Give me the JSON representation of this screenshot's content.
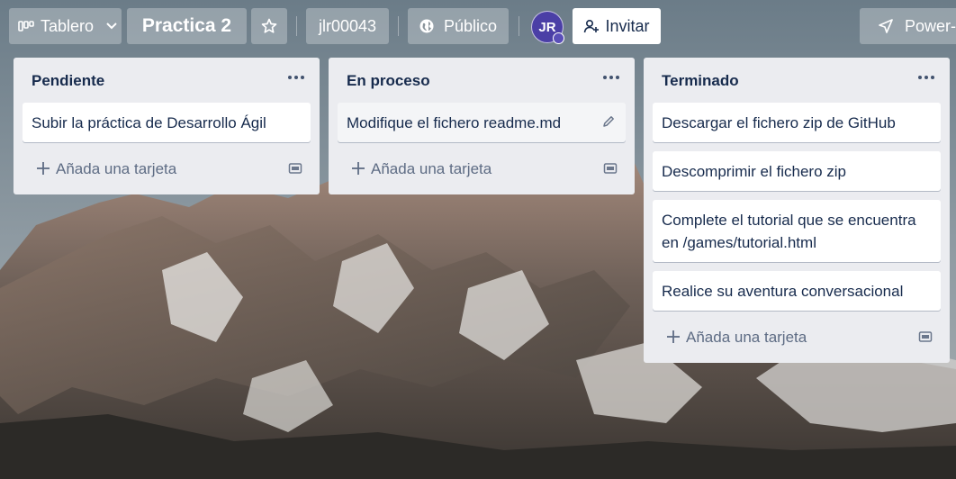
{
  "header": {
    "board_menu_label": "Tablero",
    "board_title": "Practica 2",
    "team_label": "jlr00043",
    "visibility_label": "Público",
    "avatar_initials": "JR",
    "invite_label": "Invitar",
    "powerups_label": "Power-Ups"
  },
  "lists": [
    {
      "title": "Pendiente",
      "cards": [
        "Subir la práctica de Desarrollo Ágil"
      ],
      "add_card_label": "Añada una tarjeta"
    },
    {
      "title": "En proceso",
      "cards": [
        "Modifique el fichero readme.md"
      ],
      "add_card_label": "Añada una tarjeta"
    },
    {
      "title": "Terminado",
      "cards": [
        "Descargar el fichero zip de GitHub",
        "Descomprimir el fichero zip",
        "Complete el tutorial que se encuentra en /games/tutorial.html",
        "Realice su aventura conversacional"
      ],
      "add_card_label": "Añada una tarjeta"
    }
  ],
  "colors": {
    "list_bg": "#ebecf0",
    "card_bg": "#ffffff",
    "text": "#172b4d",
    "avatar": "#4b3fa6"
  }
}
